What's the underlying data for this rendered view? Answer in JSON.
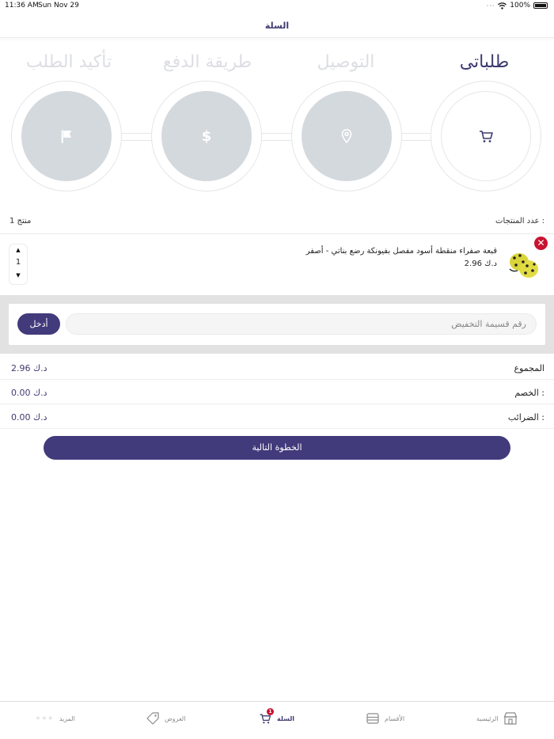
{
  "status_bar": {
    "time": "11:36 AM",
    "date": "Sun Nov 29",
    "battery": "100%"
  },
  "header": {
    "title": "السلة"
  },
  "steps": [
    {
      "label": "طلباتى",
      "icon": "cart-icon",
      "active": true
    },
    {
      "label": "التوصيل",
      "icon": "location-pin-icon",
      "active": false
    },
    {
      "label": "طريقة الدفع",
      "icon": "dollar-icon",
      "active": false
    },
    {
      "label": "تأكيد الطلب",
      "icon": "flag-icon",
      "active": false
    }
  ],
  "summary": {
    "count_label": "عدد المنتجات :",
    "count_value": "1 منتج"
  },
  "product": {
    "name": "قبعة صفراء منقطة أسود مفصل بفيونكة رضع بناتي - أصفر",
    "price": "2.96 د.ك",
    "quantity": "1"
  },
  "coupon": {
    "placeholder": "رقم قسيمة التخفيض",
    "button": "أدخل"
  },
  "totals": [
    {
      "label": "المجموع",
      "value": "2.96 د.ك"
    },
    {
      "label": "الخصم :",
      "value": "0.00 د.ك"
    },
    {
      "label": "الضرائب :",
      "value": "0.00 د.ك"
    }
  ],
  "next_button": "الخطوة التالية",
  "tab_bar": {
    "home": "الرئيسية",
    "categories": "الأقسام",
    "cart": "السلة",
    "cart_badge": "1",
    "offers": "العروض",
    "more": "المزيد"
  },
  "colors": {
    "primary": "#413a7b",
    "danger": "#c81331",
    "inactive_step": "#d4d9de"
  }
}
